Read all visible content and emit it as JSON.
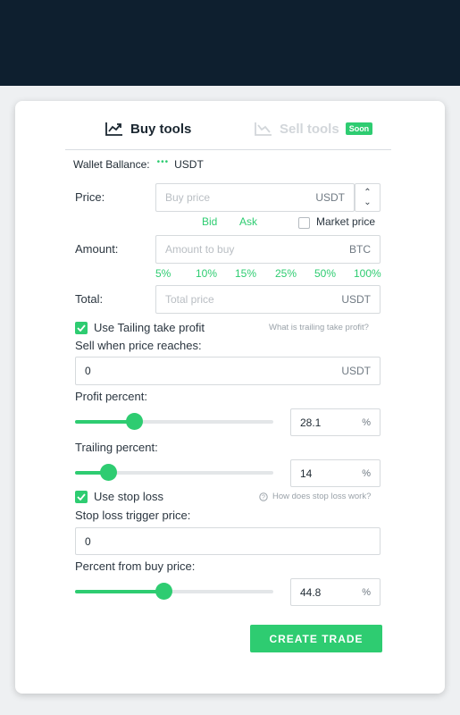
{
  "tabs": {
    "buy_label": "Buy tools",
    "sell_label": "Sell tools",
    "soon_badge": "Soon"
  },
  "wallet": {
    "label": "Wallet Ballance:",
    "loading": "•••",
    "currency": "USDT"
  },
  "price": {
    "label": "Price:",
    "placeholder": "Buy price",
    "unit": "USDT",
    "bid": "Bid",
    "ask": "Ask",
    "market_price": "Market price",
    "market_checked": false
  },
  "amount": {
    "label": "Amount:",
    "placeholder": "Amount to buy",
    "unit": "BTC",
    "percents": [
      "5%",
      "10%",
      "15%",
      "25%",
      "50%",
      "100%"
    ]
  },
  "total": {
    "label": "Total:",
    "placeholder": "Total price",
    "unit": "USDT"
  },
  "trailing_tp": {
    "checkbox_label": "Use Tailing take profit",
    "checked": true,
    "help_link": "What is trailing take profit?",
    "sell_when_label": "Sell when price reaches:",
    "sell_when_value": "0",
    "sell_when_unit": "USDT",
    "profit_label": "Profit percent:",
    "profit_value": "28.1",
    "profit_fill": 0.3,
    "trailing_label": "Trailing percent:",
    "trailing_value": "14",
    "trailing_fill": 0.17,
    "percent_unit": "%"
  },
  "stop_loss": {
    "checkbox_label": "Use stop loss",
    "checked": true,
    "help_link": "How does stop loss work?",
    "trigger_label": "Stop loss trigger price:",
    "trigger_value": "0",
    "percent_label": "Percent from buy price:",
    "percent_value": "44.8",
    "percent_fill": 0.45,
    "percent_unit": "%"
  },
  "actions": {
    "create_label": "CREATE TRADE"
  },
  "colors": {
    "accent": "#2ecc71",
    "header": "#0e1f2f"
  }
}
